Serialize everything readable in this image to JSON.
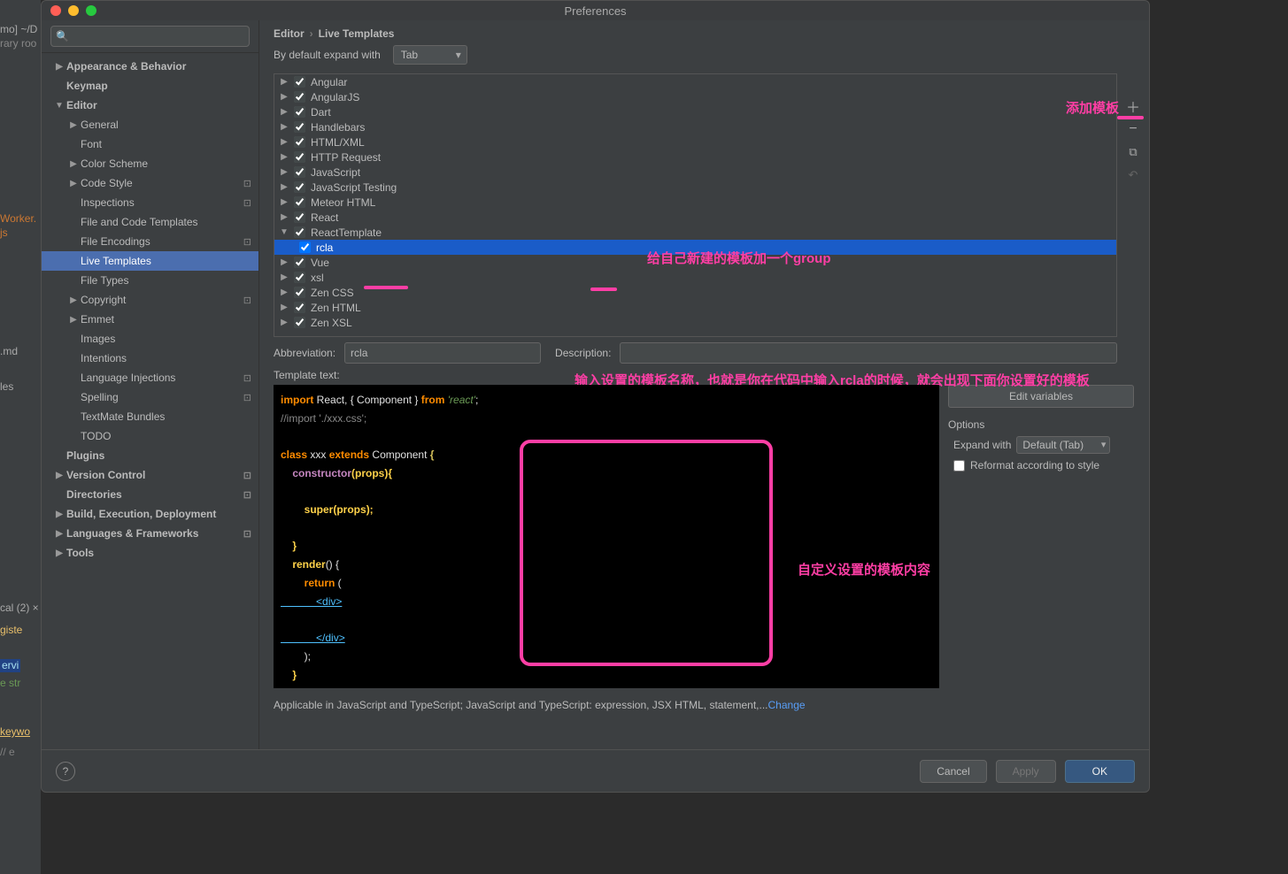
{
  "window": {
    "title": "Preferences"
  },
  "search": {
    "placeholder": ""
  },
  "sidebar": {
    "items": [
      {
        "label": "Appearance & Behavior",
        "depth": 0,
        "arrow": "▶",
        "bold": true
      },
      {
        "label": "Keymap",
        "depth": 0,
        "arrow": "",
        "bold": true
      },
      {
        "label": "Editor",
        "depth": 0,
        "arrow": "▼",
        "bold": true
      },
      {
        "label": "General",
        "depth": 1,
        "arrow": "▶"
      },
      {
        "label": "Font",
        "depth": 1,
        "arrow": ""
      },
      {
        "label": "Color Scheme",
        "depth": 1,
        "arrow": "▶"
      },
      {
        "label": "Code Style",
        "depth": 1,
        "arrow": "▶",
        "badge": "⊡"
      },
      {
        "label": "Inspections",
        "depth": 1,
        "arrow": "",
        "badge": "⊡"
      },
      {
        "label": "File and Code Templates",
        "depth": 1,
        "arrow": ""
      },
      {
        "label": "File Encodings",
        "depth": 1,
        "arrow": "",
        "badge": "⊡"
      },
      {
        "label": "Live Templates",
        "depth": 1,
        "arrow": "",
        "selected": true
      },
      {
        "label": "File Types",
        "depth": 1,
        "arrow": ""
      },
      {
        "label": "Copyright",
        "depth": 1,
        "arrow": "▶",
        "badge": "⊡"
      },
      {
        "label": "Emmet",
        "depth": 1,
        "arrow": "▶"
      },
      {
        "label": "Images",
        "depth": 1,
        "arrow": ""
      },
      {
        "label": "Intentions",
        "depth": 1,
        "arrow": ""
      },
      {
        "label": "Language Injections",
        "depth": 1,
        "arrow": "",
        "badge": "⊡"
      },
      {
        "label": "Spelling",
        "depth": 1,
        "arrow": "",
        "badge": "⊡"
      },
      {
        "label": "TextMate Bundles",
        "depth": 1,
        "arrow": ""
      },
      {
        "label": "TODO",
        "depth": 1,
        "arrow": ""
      },
      {
        "label": "Plugins",
        "depth": 0,
        "arrow": "",
        "bold": true
      },
      {
        "label": "Version Control",
        "depth": 0,
        "arrow": "▶",
        "bold": true,
        "badge": "⊡"
      },
      {
        "label": "Directories",
        "depth": 0,
        "arrow": "",
        "bold": true,
        "badge": "⊡"
      },
      {
        "label": "Build, Execution, Deployment",
        "depth": 0,
        "arrow": "▶",
        "bold": true
      },
      {
        "label": "Languages & Frameworks",
        "depth": 0,
        "arrow": "▶",
        "bold": true,
        "badge": "⊡"
      },
      {
        "label": "Tools",
        "depth": 0,
        "arrow": "▶",
        "bold": true
      }
    ]
  },
  "breadcrumb": {
    "a": "Editor",
    "sep": "›",
    "b": "Live Templates"
  },
  "expand": {
    "label": "By default expand with",
    "value": "Tab"
  },
  "groups": [
    {
      "name": "Angular",
      "expanded": false
    },
    {
      "name": "AngularJS",
      "expanded": false
    },
    {
      "name": "Dart",
      "expanded": false
    },
    {
      "name": "Handlebars",
      "expanded": false
    },
    {
      "name": "HTML/XML",
      "expanded": false
    },
    {
      "name": "HTTP Request",
      "expanded": false
    },
    {
      "name": "JavaScript",
      "expanded": false
    },
    {
      "name": "JavaScript Testing",
      "expanded": false
    },
    {
      "name": "Meteor HTML",
      "expanded": false
    },
    {
      "name": "React",
      "expanded": false
    },
    {
      "name": "ReactTemplate",
      "expanded": true,
      "items": [
        {
          "name": "rcla",
          "selected": true
        }
      ]
    },
    {
      "name": "Vue",
      "expanded": false
    },
    {
      "name": "xsl",
      "expanded": false
    },
    {
      "name": "Zen CSS",
      "expanded": false
    },
    {
      "name": "Zen HTML",
      "expanded": false
    },
    {
      "name": "Zen XSL",
      "expanded": false
    }
  ],
  "form": {
    "abbr_label": "Abbreviation:",
    "abbr_value": "rcla",
    "desc_label": "Description:",
    "desc_value": "",
    "tmpl_label": "Template text:",
    "editvars": "Edit variables"
  },
  "code": {
    "l1a": "import",
    "l1b": " React, { Component } ",
    "l1c": "from",
    "l1d": " 'react'",
    "l1e": ";",
    "l2": "//import './xxx.css';",
    "l3a": "class",
    "l3b": " xxx ",
    "l3c": "extends",
    "l3d": " Component ",
    "l3e": "{",
    "l4a": "    constructor",
    "l4b": "(props){",
    "l5a": "        super",
    "l5b": "(props);",
    "l6": "    }",
    "l7a": "    render",
    "l7b": "() {",
    "l8a": "        return",
    "l8b": " (",
    "l9": "            <div>",
    "l10": "            </div>",
    "l11": "        );",
    "l12": "    }",
    "l13": "}"
  },
  "options": {
    "title": "Options",
    "expand_label": "Expand with",
    "expand_value": "Default (Tab)",
    "reformat": "Reformat according to style"
  },
  "applicable": {
    "text": "Applicable in JavaScript and TypeScript; JavaScript and TypeScript: expression, JSX HTML, statement,...",
    "change": "Change"
  },
  "footer": {
    "cancel": "Cancel",
    "apply": "Apply",
    "ok": "OK"
  },
  "annotations": {
    "a1": "添加模板",
    "a2": "给自己新建的模板加一个group",
    "a3": "输入设置的模板名称，也就是你在代码中输入rcla的时候，就会出现下面你设置好的模板",
    "a4": "自定义设置的模板内容"
  },
  "behind": {
    "t1": "mo]  ~/D",
    "t2": "rary roo",
    "t3": "Worker.",
    "t4": "js",
    "t5": ".md",
    "t6": "les",
    "t7": "cal (2)  ×",
    "t8": "giste",
    "t9": "ervi",
    "t10": "e str",
    "t11": "keywo",
    "t12": "// e"
  }
}
